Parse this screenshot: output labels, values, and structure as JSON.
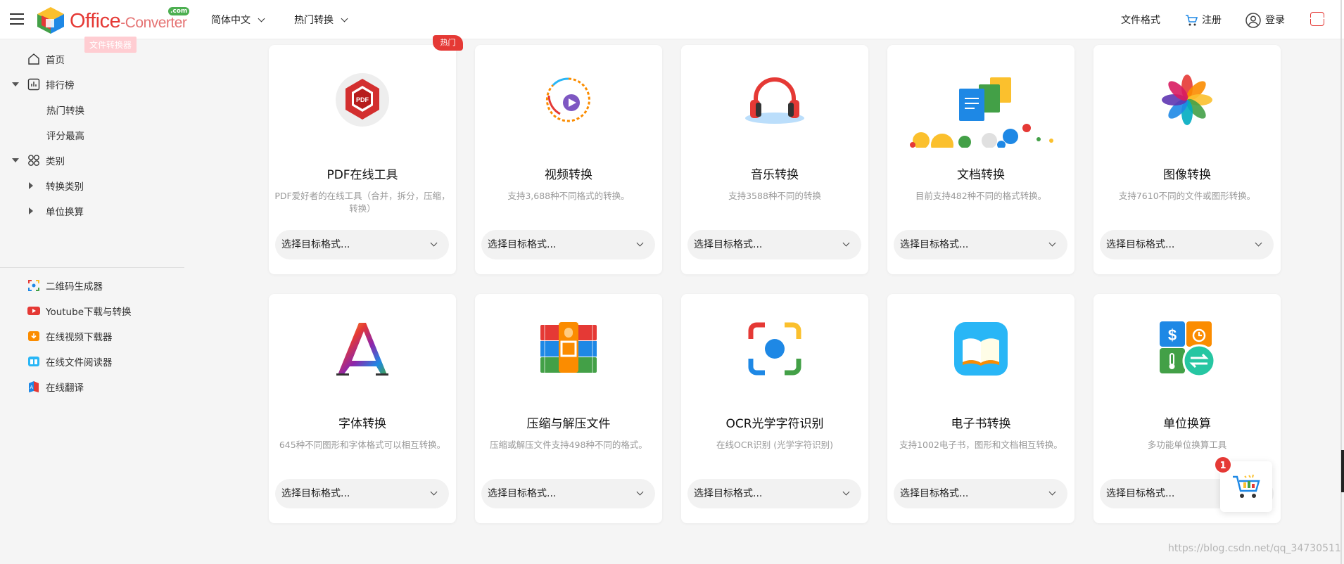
{
  "header": {
    "logo_office": "Office",
    "logo_dash": "-",
    "logo_converter": "Converter",
    "logo_com": ".com",
    "logo_tooltip": "文件转换器",
    "lang": "简体中文",
    "popular": "热门转换",
    "formats": "文件格式",
    "register": "注册",
    "login": "登录"
  },
  "sidebar": {
    "home": "首页",
    "ranking": "排行榜",
    "hot": "热门转换",
    "top_rated": "评分最高",
    "category": "类别",
    "convert_category": "转换类别",
    "unit_convert": "单位换算",
    "tools": [
      {
        "label": "二维码生成器",
        "icon": "qr-icon"
      },
      {
        "label": "Youtube下载与转换",
        "icon": "youtube-icon"
      },
      {
        "label": "在线视频下载器",
        "icon": "video-download-icon"
      },
      {
        "label": "在线文件阅读器",
        "icon": "file-reader-icon"
      },
      {
        "label": "在线翻译",
        "icon": "translate-icon"
      }
    ]
  },
  "hot_badge": "热门",
  "cards": [
    {
      "title": "PDF在线工具",
      "desc": "PDF爱好者的在线工具（合并，拆分，压缩，转换）",
      "select": "选择目标格式..."
    },
    {
      "title": "视频转换",
      "desc": "支持3,688种不同格式的转换。",
      "select": "选择目标格式..."
    },
    {
      "title": "音乐转换",
      "desc": "支持3588种不同的转换",
      "select": "选择目标格式..."
    },
    {
      "title": "文档转换",
      "desc": "目前支持482种不同的格式转换。",
      "select": "选择目标格式..."
    },
    {
      "title": "图像转换",
      "desc": "支持7610不同的文件或图形转换。",
      "select": "选择目标格式..."
    },
    {
      "title": "字体转换",
      "desc": "645种不同图形和字体格式可以相互转换。",
      "select": "选择目标格式..."
    },
    {
      "title": "压缩与解压文件",
      "desc": "压缩或解压文件支持498种不同的格式。",
      "select": "选择目标格式..."
    },
    {
      "title": "OCR光学字符识别",
      "desc": "在线OCR识别 (光学字符识别)",
      "select": "选择目标格式..."
    },
    {
      "title": "电子书转换",
      "desc": "支持1002电子书，图形和文档相互转换。",
      "select": "选择目标格式..."
    },
    {
      "title": "单位换算",
      "desc": "多功能单位换算工具",
      "select": "选择目标格式..."
    }
  ],
  "cart_count": "1",
  "watermark": "https://blog.csdn.net/qq_34730511",
  "colors": {
    "brand_red": "#e53935",
    "card_bg": "#ffffff",
    "page_bg": "#f5f5f5"
  }
}
